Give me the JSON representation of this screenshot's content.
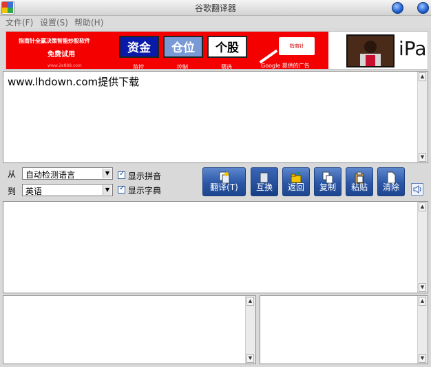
{
  "window": {
    "title": "谷歌翻译器"
  },
  "menu": {
    "file": "文件(F)",
    "settings": "设置(S)",
    "help": "帮助(H)"
  },
  "ad": {
    "line1": "指南针全赢决策智能炒股软件",
    "line2": "免费试用",
    "site": "www.2e888.com",
    "box1": "资金",
    "box2": "仓位",
    "box3": "个股",
    "sub1": "监控",
    "sub2": "控制",
    "sub3": "筛选",
    "logo": "指南针",
    "google": "Google 提供的广告",
    "ipad": "iPa"
  },
  "source": {
    "text": "www.lhdown.com提供下载"
  },
  "controls": {
    "from_label": "从",
    "to_label": "到",
    "from_value": "自动检测语言",
    "to_value": "英语",
    "show_pinyin": "显示拼音",
    "show_dict": "显示字典"
  },
  "buttons": {
    "translate": "翻译(T)",
    "swap": "互换",
    "back": "返回",
    "copy": "复制",
    "paste": "粘贴",
    "clear": "清除"
  },
  "colors": {
    "ad_red": "#f40000",
    "button_blue": "#2a56a6"
  }
}
